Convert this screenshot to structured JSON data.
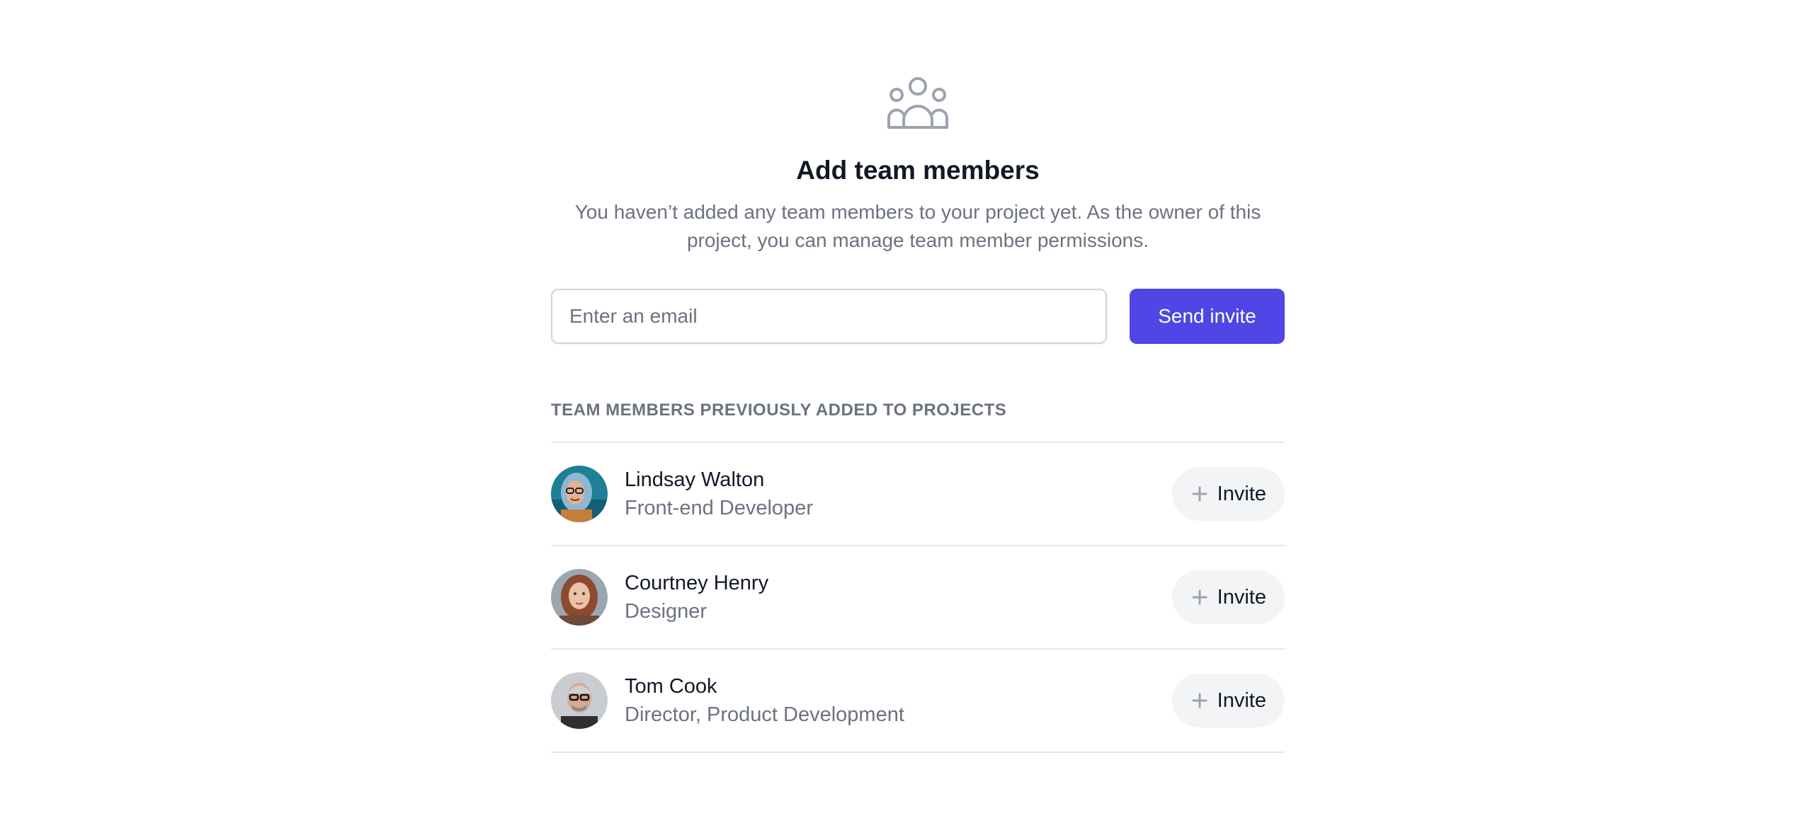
{
  "header": {
    "icon": "team-users-icon",
    "title": "Add team members",
    "subtitle": "You haven’t added any team members to your project yet. As the owner of this project, you can manage team member permissions."
  },
  "invite_form": {
    "email_placeholder": "Enter an email",
    "email_value": "",
    "send_label": "Send invite"
  },
  "section_heading": "Team members previously added to projects",
  "members": [
    {
      "name": "Lindsay Walton",
      "role": "Front-end Developer",
      "invite_label": "Invite",
      "invite_icon": "plus-icon"
    },
    {
      "name": "Courtney Henry",
      "role": "Designer",
      "invite_label": "Invite",
      "invite_icon": "plus-icon"
    },
    {
      "name": "Tom Cook",
      "role": "Director, Product Development",
      "invite_label": "Invite",
      "invite_icon": "plus-icon"
    }
  ],
  "colors": {
    "accent": "#4f46e5",
    "muted_text": "#6b7280",
    "divider": "#e5e7eb",
    "button_bg": "#f3f4f6"
  }
}
